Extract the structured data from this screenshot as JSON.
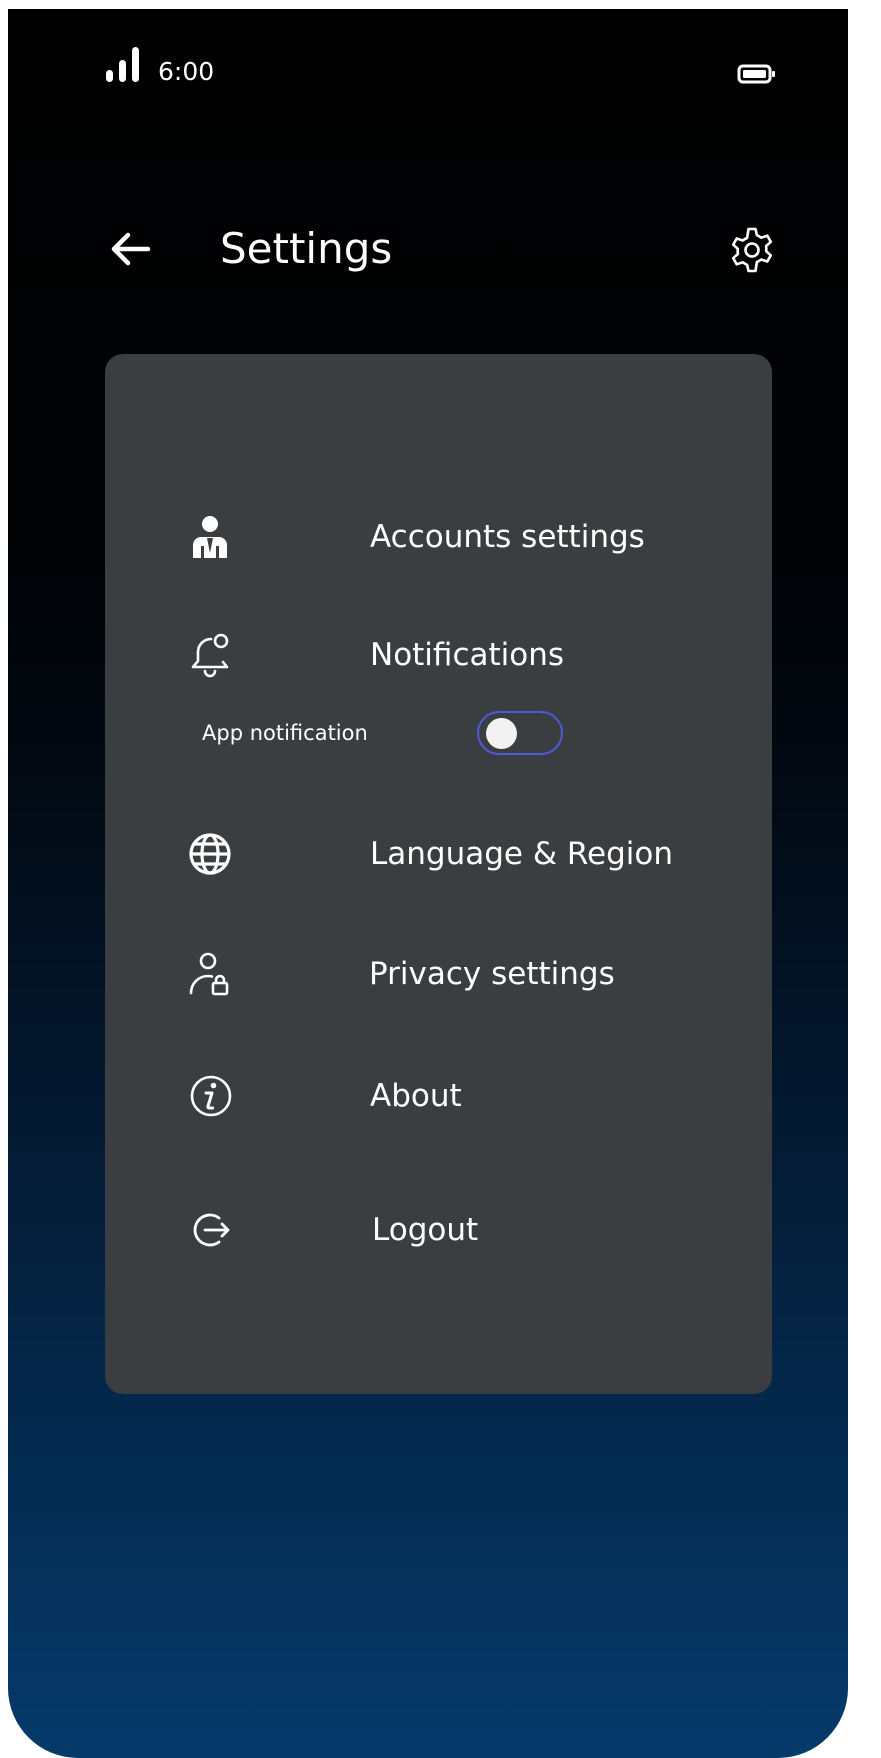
{
  "status_bar": {
    "time": "6:00",
    "signal_icon": "signal-bars-icon",
    "battery_icon": "battery-icon"
  },
  "header": {
    "title": "Settings",
    "back_icon": "arrow-left-icon",
    "settings_icon": "gear-icon"
  },
  "menu": {
    "accounts": {
      "label": "Accounts settings",
      "icon": "user-tie-icon"
    },
    "notifications": {
      "label": "Notifications",
      "icon": "bell-icon",
      "app_notification": {
        "label": "App notification",
        "enabled": false
      }
    },
    "language": {
      "label": "Language & Region",
      "icon": "globe-icon"
    },
    "privacy": {
      "label": "Privacy settings",
      "icon": "user-lock-icon"
    },
    "about": {
      "label": "About",
      "icon": "info-icon"
    },
    "logout": {
      "label": "Logout",
      "icon": "logout-icon"
    }
  },
  "colors": {
    "card_background": "#3a3e40",
    "toggle_border": "#4f5ad8",
    "gradient_bottom": "#053a6b"
  }
}
